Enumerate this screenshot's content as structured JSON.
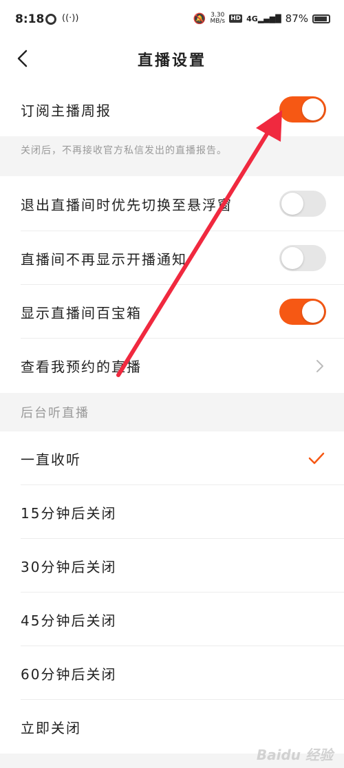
{
  "status_bar": {
    "time": "8:18",
    "speed_value": "3.30",
    "speed_unit": "MB/s",
    "hd": "HD",
    "network": "4G",
    "battery": "87%"
  },
  "header": {
    "title": "直播设置"
  },
  "settings": {
    "weekly_report": {
      "label": "订阅主播周报",
      "on": true
    },
    "weekly_hint": "关闭后，不再接收官方私信发出的直播报告。",
    "float_window": {
      "label": "退出直播间时优先切换至悬浮窗",
      "on": false
    },
    "no_notice": {
      "label": "直播间不再显示开播通知",
      "on": false
    },
    "treasure_box": {
      "label": "显示直播间百宝箱",
      "on": true
    },
    "my_bookings": {
      "label": "查看我预约的直播"
    }
  },
  "background_listen": {
    "header": "后台听直播",
    "options": [
      {
        "label": "一直收听",
        "selected": true
      },
      {
        "label": "15分钟后关闭",
        "selected": false
      },
      {
        "label": "30分钟后关闭",
        "selected": false
      },
      {
        "label": "45分钟后关闭",
        "selected": false
      },
      {
        "label": "60分钟后关闭",
        "selected": false
      },
      {
        "label": "立即关闭",
        "selected": false
      }
    ]
  },
  "watermark": "Baidu 经验",
  "colors": {
    "accent": "#f65814",
    "annotation_arrow": "#f0293f"
  }
}
